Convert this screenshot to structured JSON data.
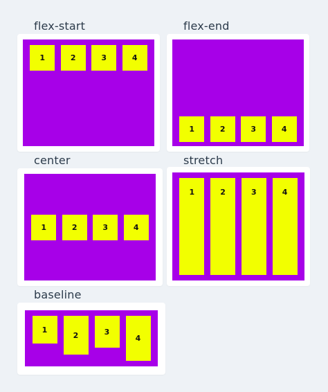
{
  "colors": {
    "page_background": "#eef2f6",
    "card_background": "#ffffff",
    "container_fill": "#a700e8",
    "item_fill": "#f2ff00",
    "label_color": "#2b3a4a"
  },
  "examples": [
    {
      "title": "flex-start",
      "align_items": "flex-start",
      "items": [
        "1",
        "2",
        "3",
        "4"
      ]
    },
    {
      "title": "flex-end",
      "align_items": "flex-end",
      "items": [
        "1",
        "2",
        "3",
        "4"
      ]
    },
    {
      "title": "center",
      "align_items": "center",
      "items": [
        "1",
        "2",
        "3",
        "4"
      ]
    },
    {
      "title": "stretch",
      "align_items": "stretch",
      "items": [
        "1",
        "2",
        "3",
        "4"
      ]
    },
    {
      "title": "baseline",
      "align_items": "baseline",
      "items": [
        "1",
        "2",
        "3",
        "4"
      ]
    }
  ]
}
